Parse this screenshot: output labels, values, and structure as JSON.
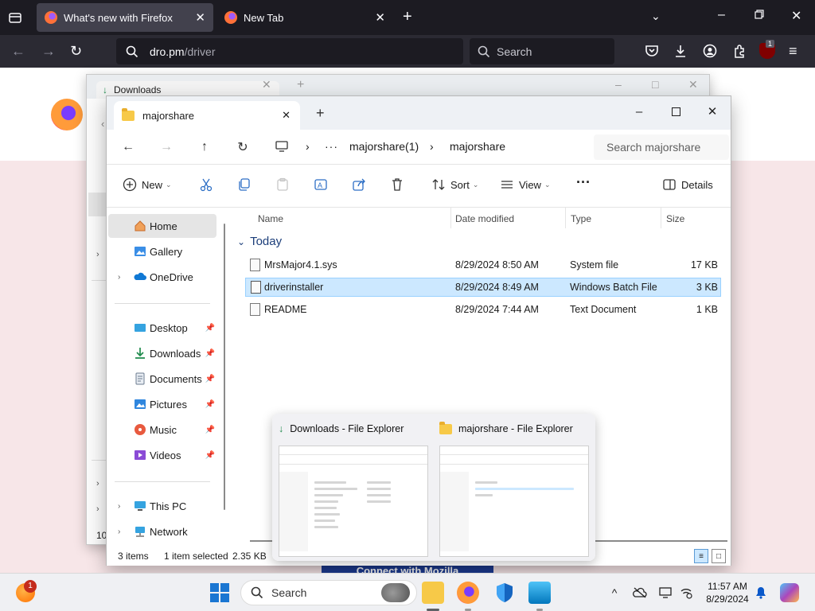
{
  "firefox": {
    "tabs": [
      {
        "title": "What's new with Firefox",
        "active": true
      },
      {
        "title": "New Tab",
        "active": false
      }
    ],
    "url_host": "dro.pm",
    "url_path": "/driver",
    "search_placeholder": "Search",
    "extension_badge": "1",
    "page_banner": "Connect with Mozilla"
  },
  "bg_window": {
    "tab_title": "Downloads",
    "side_count": "10"
  },
  "explorer": {
    "tab_title": "majorshare",
    "breadcrumb": [
      "majorshare(1)",
      "majorshare"
    ],
    "search_placeholder": "Search majorshare",
    "toolbar": {
      "new_label": "New",
      "sort_label": "Sort",
      "view_label": "View",
      "details_label": "Details"
    },
    "sidebar": {
      "items": [
        {
          "label": "Home",
          "icon": "home-icon"
        },
        {
          "label": "Gallery",
          "icon": "gallery-icon"
        },
        {
          "label": "OneDrive",
          "icon": "onedrive-icon"
        },
        {
          "label": "Desktop",
          "icon": "desktop-icon"
        },
        {
          "label": "Downloads",
          "icon": "downloads-icon"
        },
        {
          "label": "Documents",
          "icon": "documents-icon"
        },
        {
          "label": "Pictures",
          "icon": "pictures-icon"
        },
        {
          "label": "Music",
          "icon": "music-icon"
        },
        {
          "label": "Videos",
          "icon": "videos-icon"
        },
        {
          "label": "This PC",
          "icon": "this-pc-icon"
        },
        {
          "label": "Network",
          "icon": "network-icon"
        }
      ]
    },
    "columns": [
      "Name",
      "Date modified",
      "Type",
      "Size"
    ],
    "group": "Today",
    "files": [
      {
        "name": "MrsMajor4.1.sys",
        "date": "8/29/2024 8:50 AM",
        "type": "System file",
        "size": "17 KB",
        "selected": false
      },
      {
        "name": "driverinstaller",
        "date": "8/29/2024 8:49 AM",
        "type": "Windows Batch File",
        "size": "3 KB",
        "selected": true
      },
      {
        "name": "README",
        "date": "8/29/2024 7:44 AM",
        "type": "Text Document",
        "size": "1 KB",
        "selected": false
      }
    ],
    "status": {
      "items": "3 items",
      "selected": "1 item selected",
      "size": "2.35 KB"
    }
  },
  "thumbnails": [
    {
      "title": "Downloads - File Explorer"
    },
    {
      "title": "majorshare - File Explorer"
    }
  ],
  "taskbar": {
    "search_label": "Search",
    "notification_badge": "1",
    "time": "11:57 AM",
    "date": "8/29/2024"
  }
}
